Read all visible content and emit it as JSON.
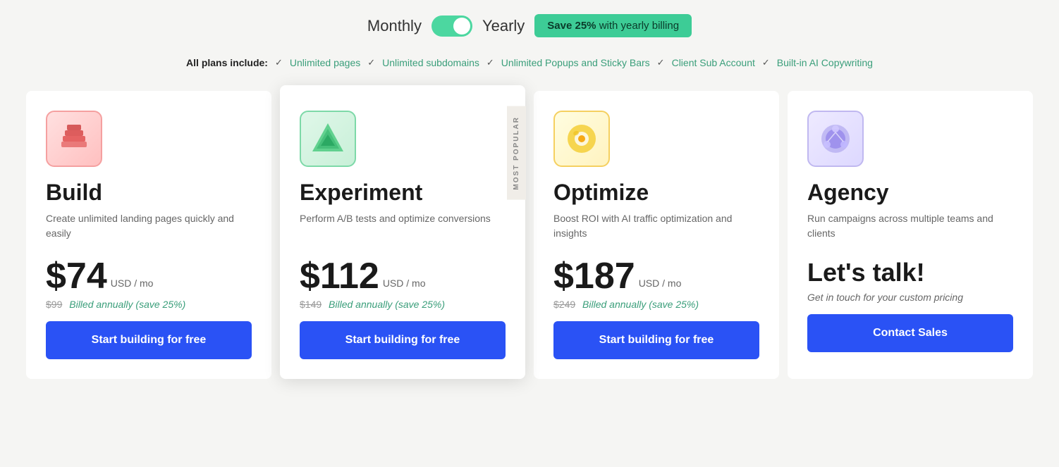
{
  "billing": {
    "monthly_label": "Monthly",
    "yearly_label": "Yearly",
    "save_badge": "Save 25%",
    "save_suffix": " with yearly billing",
    "toggle_active": "yearly"
  },
  "plans_include": {
    "label": "All plans include:",
    "items": [
      "Unlimited pages",
      "Unlimited subdomains",
      "Unlimited Popups and Sticky Bars",
      "Client Sub Account",
      "Built-in AI Copywriting"
    ]
  },
  "plans": [
    {
      "id": "build",
      "name": "Build",
      "desc": "Create unlimited landing pages quickly and easily",
      "price": "$74",
      "price_unit": "USD / mo",
      "original_price": "$99",
      "billed_note": "Billed annually (save 25%)",
      "cta": "Start building for free",
      "popular": false,
      "icon_color": "build"
    },
    {
      "id": "experiment",
      "name": "Experiment",
      "desc": "Perform A/B tests and optimize conversions",
      "price": "$112",
      "price_unit": "USD / mo",
      "original_price": "$149",
      "billed_note": "Billed annually (save 25%)",
      "cta": "Start building for free",
      "popular": true,
      "icon_color": "experiment"
    },
    {
      "id": "optimize",
      "name": "Optimize",
      "desc": "Boost ROI with AI traffic optimization and insights",
      "price": "$187",
      "price_unit": "USD / mo",
      "original_price": "$249",
      "billed_note": "Billed annually (save 25%)",
      "cta": "Start building for free",
      "popular": false,
      "icon_color": "optimize"
    },
    {
      "id": "agency",
      "name": "Agency",
      "desc": "Run campaigns across multiple teams and clients",
      "price": null,
      "price_headline": "Let's talk!",
      "custom_pricing": "Get in touch for your custom pricing",
      "cta": "Contact Sales",
      "popular": false,
      "icon_color": "agency"
    }
  ],
  "most_popular_text": "MOST POPULAR"
}
